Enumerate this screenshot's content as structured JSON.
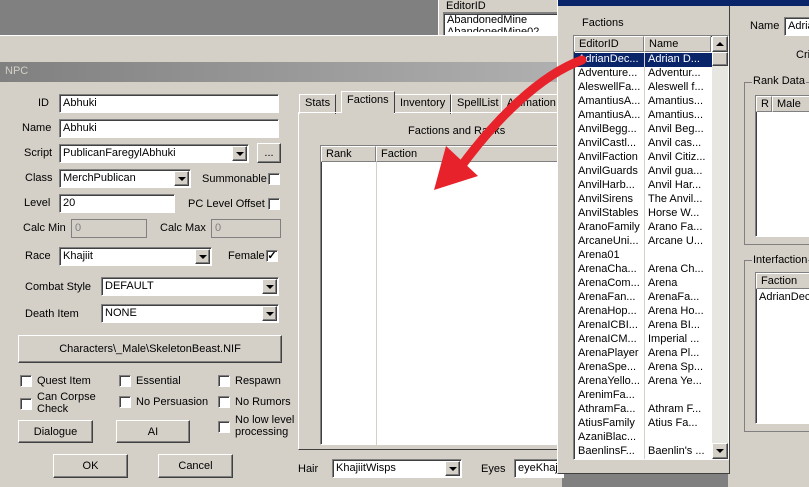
{
  "bg_top": {
    "editor_header": "EditorID",
    "items": [
      "AbandonedMine",
      "AbandonedMine02"
    ]
  },
  "npc": {
    "title": "NPC",
    "labels": {
      "id": "ID",
      "name": "Name",
      "script": "Script",
      "class": "Class",
      "summonable": "Summonable",
      "level": "Level",
      "pc_offset": "PC Level Offset",
      "calc_min": "Calc Min",
      "calc_max": "Calc Max",
      "race": "Race",
      "female": "Female",
      "combat_style": "Combat Style",
      "death_item": "Death Item",
      "hair": "Hair",
      "eyes": "Eyes"
    },
    "values": {
      "id": "Abhuki",
      "name": "Abhuki",
      "script": "PublicanFaregylAbhuki",
      "script_btn": "...",
      "class": "MerchPublican",
      "level": "20",
      "calc_min": "0",
      "calc_max": "0",
      "race": "Khajiit",
      "combat_style": "DEFAULT",
      "death_item": "NONE",
      "model": "Characters\\_Male\\SkeletonBeast.NIF",
      "hair": "KhajiitWisps",
      "eyes": "eyeKhajiit"
    },
    "female_checked": "✓",
    "checks": {
      "quest_item": "Quest Item",
      "essential": "Essential",
      "respawn": "Respawn",
      "can_corpse_check": "Can Corpse Check",
      "no_persuasion": "No Persuasion",
      "no_rumors": "No Rumors",
      "no_low_level": "No low level processing"
    },
    "buttons": {
      "dialogue": "Dialogue",
      "ai": "AI",
      "ok": "OK",
      "cancel": "Cancel"
    },
    "tabs": [
      "Stats",
      "Factions",
      "Inventory",
      "SpellList",
      "Animation"
    ],
    "factions_group": "Factions and Ranks",
    "factions_cols": [
      "Rank",
      "Faction"
    ]
  },
  "factions_win": {
    "title": "Factions",
    "cols": [
      "EditorID",
      "Name"
    ],
    "rows": [
      [
        "AdrianDec...",
        "Adrian D..."
      ],
      [
        "Adventure...",
        "Adventur..."
      ],
      [
        "AleswellFa...",
        "Aleswell f..."
      ],
      [
        "AmantiusA...",
        "Amantius..."
      ],
      [
        "AmantiusA...",
        "Amantius..."
      ],
      [
        "AnvilBegg...",
        "Anvil Beg..."
      ],
      [
        "AnvilCastl...",
        "Anvil cas..."
      ],
      [
        "AnvilFaction",
        "Anvil Citiz..."
      ],
      [
        "AnvilGuards",
        "Anvil gua..."
      ],
      [
        "AnvilHarb...",
        "Anvil Har..."
      ],
      [
        "AnvilSirens",
        "The Anvil..."
      ],
      [
        "AnvilStables",
        "Horse W..."
      ],
      [
        "AranoFamily",
        "Arano Fa..."
      ],
      [
        "ArcaneUni...",
        "Arcane U..."
      ],
      [
        "Arena01",
        ""
      ],
      [
        "ArenaCha...",
        "Arena Ch..."
      ],
      [
        "ArenaCom...",
        "Arena"
      ],
      [
        "ArenaFan...",
        "ArenaFa..."
      ],
      [
        "ArenaHop...",
        "Arena Ho..."
      ],
      [
        "ArenaICBI...",
        "Arena BI..."
      ],
      [
        "ArenaICM...",
        "Imperial ..."
      ],
      [
        "ArenaPlayer",
        "Arena Pl..."
      ],
      [
        "ArenaSpe...",
        "Arena Sp..."
      ],
      [
        "ArenaYello...",
        "Arena Ye..."
      ],
      [
        "ArenimFa...",
        ""
      ],
      [
        "AthramFa...",
        "Athram F..."
      ],
      [
        "AtiusFamily",
        "Atius Fa..."
      ],
      [
        "AzaniBlac...",
        ""
      ],
      [
        "BaenlinsF...",
        "Baenlin's ..."
      ]
    ]
  },
  "right_win": {
    "name_label": "Name",
    "name_value": "Adria",
    "cri": "Cri",
    "rank_data": "Rank Data",
    "rank_cols": [
      "R",
      "Male"
    ],
    "interfaction": "Interfaction",
    "inter_col": "Faction",
    "inter_row": "AdrianDec"
  },
  "colors": {
    "arrow": "#e8222a",
    "selection": "#0a246a",
    "title_active": "#0a246a"
  }
}
